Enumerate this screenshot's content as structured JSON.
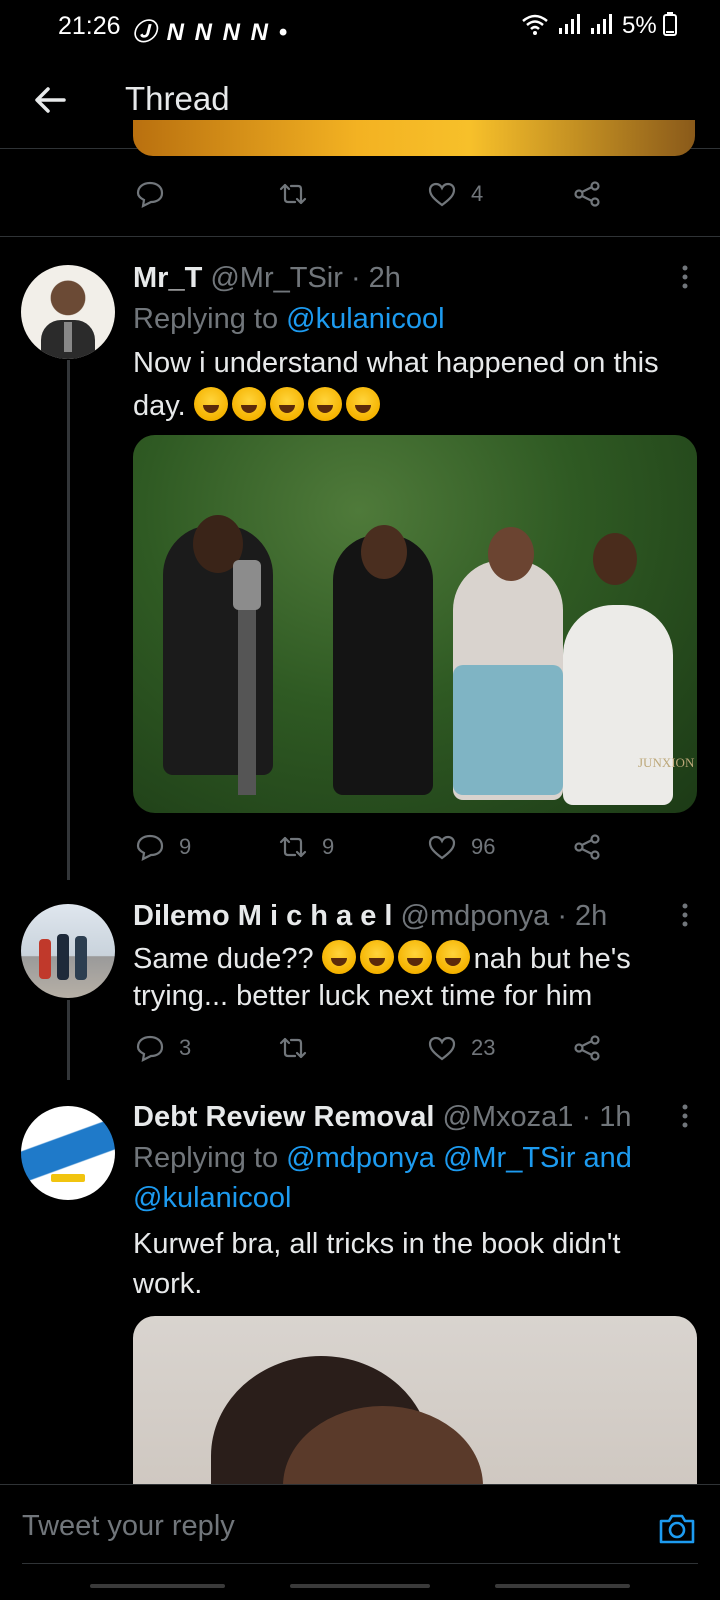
{
  "status_bar": {
    "time": "21:26",
    "notification_icons": "Ⓙ N N N N •",
    "battery": "5%"
  },
  "header": {
    "title": "Thread"
  },
  "prev_tweet_actions": {
    "likes": "4"
  },
  "tweets": [
    {
      "name": "Mr_T",
      "handle": "@Mr_TSir",
      "time": "· 2h",
      "replying_prefix": "Replying to",
      "replying_to": "@kulanicool",
      "text_line1": "Now i understand what happened on this",
      "text_line2": "day.",
      "replies": "9",
      "retweets": "9",
      "likes": "96",
      "media_watermark": "JUNXION"
    },
    {
      "name": "Dilemo M i c h a e l",
      "handle": "@mdponya",
      "time": "· 2h",
      "text_line1_a": "Same dude??",
      "text_line1_b": "nah but he's",
      "text_line2": "trying... better luck next time for him",
      "replies": "3",
      "likes": "23"
    },
    {
      "name": "Debt Review Removal",
      "handle": "@Mxoza1",
      "time": "· 1h",
      "replying_prefix": "Replying to",
      "replying_to_line1": "@mdponya @Mr_TSir and",
      "replying_to_line2": "@kulanicool",
      "text_line1": "Kurwef bra, all tricks in the book didn't",
      "text_line2": "work."
    }
  ],
  "reply_input": {
    "placeholder": "Tweet your reply"
  },
  "colors": {
    "accent": "#1d9bf0",
    "muted": "#71767b",
    "background": "#000000",
    "divider": "#2f3336"
  }
}
